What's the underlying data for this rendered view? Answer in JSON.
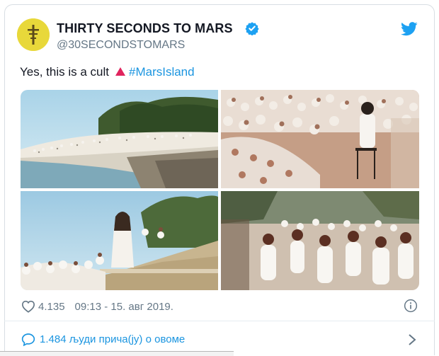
{
  "tweet": {
    "author_name": "THIRTY SECONDS TO MARS",
    "handle": "@30SECONDSTOMARS",
    "text": "Yes, this is a cult",
    "hashtag": "#MarsIsland",
    "likes": "4.135",
    "timestamp": "09:13 - 15. авг 2019.",
    "conversation": "1.484 људи прича(ју) о овоме"
  },
  "icons": {
    "avatar": "cross-emblem-icon",
    "verified": "verified-badge-icon",
    "brand": "twitter-bird-icon",
    "emoji": "red-triangle-icon",
    "like": "heart-icon",
    "info": "info-icon",
    "reply": "speech-bubble-icon",
    "more": "chevron-right-icon"
  },
  "colors": {
    "accent": "#1b95e0",
    "text": "#141823",
    "muted": "#657786",
    "avatar_bg": "#e8d83a",
    "triangle": "#e0245e"
  },
  "images": [
    {
      "name": "photo-crowd-on-coast"
    },
    {
      "name": "photo-crowd-seated-around-speaker"
    },
    {
      "name": "photo-man-in-white-robe"
    },
    {
      "name": "photo-crowd-dancing"
    }
  ]
}
